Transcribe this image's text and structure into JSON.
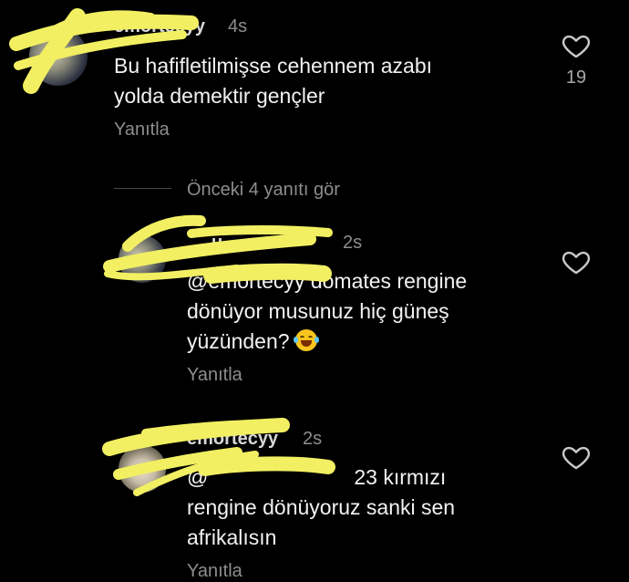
{
  "comments": [
    {
      "username": "emortecyy",
      "time": "4s",
      "text_line1": "Bu hafifletilmişse cehennem azabı",
      "text_line2": "yolda demektir gençler",
      "reply_label": "Yanıtla",
      "likes": "19"
    }
  ],
  "view_previous_label": "Önceki 4 yanıtı gör",
  "replies": [
    {
      "username": "u",
      "time": "2s",
      "mention": "@emortecyy",
      "text_line1": " domates rengine",
      "text_line2": "dönüyor musunuz hiç güneş",
      "text_line3": "yüzünden?",
      "emoji": "face-with-tears-of-joy",
      "reply_label": "Yanıtla"
    },
    {
      "username": "emortecyy",
      "time": "2s",
      "mention_partial": "@",
      "text_line1": "23 kırmızı",
      "text_line2": "rengine dönüyoruz sanki sen",
      "text_line3": "afrikalısın",
      "reply_label": "Yanıtla"
    }
  ],
  "icons": {
    "like": "heart-outline-icon"
  },
  "colors": {
    "background": "#000000",
    "redaction": "#f2ef62",
    "muted_text": "#8d8d8d"
  }
}
